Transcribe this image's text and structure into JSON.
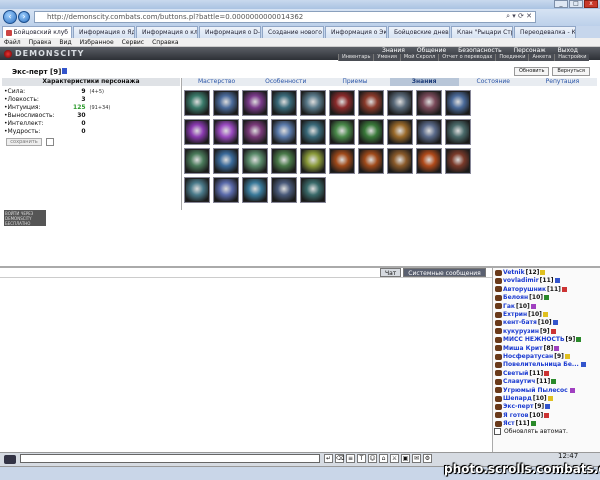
{
  "browser": {
    "title": "http://demonscity.combats.com/buttons.pl?battle=0.0000000000014362",
    "address": "http://demonscity.combats.com/buttons.pl?battle=0.0000000000014362",
    "tabs": [
      {
        "label": "Бойцовский клуб",
        "active": true
      },
      {
        "label": "Информация о Ядо..."
      },
      {
        "label": "Информация о кл..."
      },
      {
        "label": "Информация о D-..."
      },
      {
        "label": "Создание нового т..."
      },
      {
        "label": "Информация о Эк..."
      },
      {
        "label": "Бойцовские днев..."
      },
      {
        "label": "Клан \"Рыцари Стр..."
      },
      {
        "label": "Переодевалка - К..."
      }
    ],
    "menu": [
      "Файл",
      "Правка",
      "Вид",
      "Избранное",
      "Сервис",
      "Справка"
    ]
  },
  "game": {
    "logo": "DEMONSCITY",
    "nav": [
      "Знания",
      "Общение",
      "Безопасность",
      "Персонаж",
      "Выход"
    ],
    "subnav": [
      "Инвентарь",
      "Умения",
      "Мой Скролл",
      "Отчет о переводах",
      "Поединки",
      "Анкета",
      "Настройки"
    ],
    "character": {
      "name": "Экс-перт",
      "level": "[9]"
    },
    "buttons": {
      "refresh": "Обновить",
      "back": "Вернуться"
    },
    "stats_title": "Характеристики персонажа",
    "stats": [
      {
        "name": "Сила:",
        "value": "9",
        "extra": "(4+5)"
      },
      {
        "name": "Ловкость:",
        "value": "3",
        "extra": ""
      },
      {
        "name": "Интуиция:",
        "value": "125",
        "extra": "(91+34)"
      },
      {
        "name": "Выносливость:",
        "value": "30",
        "extra": ""
      },
      {
        "name": "Интеллект:",
        "value": "0",
        "extra": ""
      },
      {
        "name": "Мудрость:",
        "value": "0",
        "extra": ""
      }
    ],
    "save_label": "сохранить",
    "banner": "ВОЙТИ ЧЕРЕЗ \nDEMONSCITY \nБЕСПЛАТНО",
    "section_tabs": [
      {
        "label": "Мастерство"
      },
      {
        "label": "Особенности"
      },
      {
        "label": "Приемы"
      },
      {
        "label": "Знания",
        "active": true
      },
      {
        "label": "Состояние"
      },
      {
        "label": "Репутация"
      }
    ],
    "cards": [
      "#3a7a6a",
      "#4a6a9a",
      "#7a3a8a",
      "#3a6a7a",
      "#5a7a8a",
      "#8a2a2a",
      "#8a3a2a",
      "#5a6a7a",
      "#7a4a5a",
      "#4a6a9a",
      "#8a3ab0",
      "#9a4ac0",
      "#7a3a7a",
      "#5a7aaa",
      "#3a6a7a",
      "#4a8a4a",
      "#3a7a3a",
      "#9a6a2a",
      "#5a6a8a",
      "#4a6a6a",
      "#4a7a5a",
      "#3a6a9a",
      "#5a8a6a",
      "#4a7a4a",
      "#8a9a3a",
      "#a04a1a",
      "#a04a1a",
      "#8a5a2a",
      "#b04a1a",
      "#7a3a2a",
      "#4a7a8a",
      "#5a6aaa",
      "#3a7a9a",
      "#4a5a7a",
      "#3a6a6a"
    ]
  },
  "chat": {
    "tabs": [
      {
        "label": "Чат"
      },
      {
        "label": "Системные сообщения",
        "active": true
      }
    ],
    "users": [
      {
        "name": "Vetnik",
        "level": "[12]"
      },
      {
        "name": "vovladimir",
        "level": "[11]"
      },
      {
        "name": "Авторушник",
        "level": "[11]"
      },
      {
        "name": "Белоян",
        "level": "[10]"
      },
      {
        "name": "Гак",
        "level": "[10]"
      },
      {
        "name": "Ехтрин",
        "level": "[10]"
      },
      {
        "name": "кент-батя",
        "level": "[10]"
      },
      {
        "name": "кукурузин",
        "level": "[9]"
      },
      {
        "name": "МИСС НЕЖНОСТЬ",
        "level": "[9]"
      },
      {
        "name": "Миша Крит",
        "level": "[8]"
      },
      {
        "name": "Носфератусан",
        "level": "[9]"
      },
      {
        "name": "Повелительница Бе...",
        "level": ""
      },
      {
        "name": "Светый",
        "level": "[11]"
      },
      {
        "name": "Славутич",
        "level": "[11]"
      },
      {
        "name": "Угрюмый Пылесос",
        "level": ""
      },
      {
        "name": "Шепард",
        "level": "[10]"
      },
      {
        "name": "Экс-перт",
        "level": "[9]"
      },
      {
        "name": "Я готов",
        "level": "[10]"
      },
      {
        "name": "Яст",
        "level": "[11]"
      }
    ],
    "auto_update": "Обновлять автомат."
  },
  "clock": "12:47",
  "watermark": "photo.scrolls.combats.com"
}
